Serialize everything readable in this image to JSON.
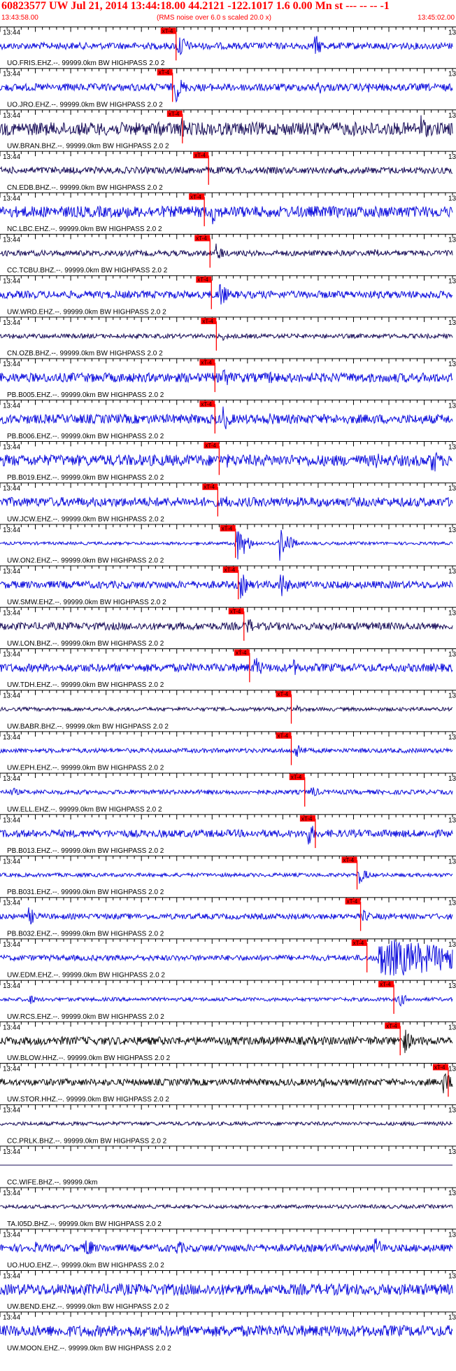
{
  "header": {
    "title": "60823577 UW Jul 21, 2014 13:44:18.00   44.2121 -122.1017  1.6 0.00 Mn st --- -- --  -1",
    "start_time": "13:43:58.00",
    "subtitle": "(RMS noise over 6.0 s scaled 20.0 x)",
    "end_time": "13:45:02.00"
  },
  "colors": {
    "header_text": "#ff0000",
    "pick": "#ff0000",
    "pick_label_text": "#000000",
    "axis": "#000000",
    "trace_blue": "#1010dd",
    "trace_navy": "#1a0f5a",
    "trace_black": "#111111"
  },
  "chart_data": {
    "type": "line",
    "x_unit": "time",
    "x_range": [
      "13:43:58.00",
      "13:45:02.00"
    ],
    "tick_time_label": "13:44",
    "right_edge_label": "13",
    "pick_label": "xT-4",
    "series": [
      {
        "name": "UO.FRIS.EHZ.--. 99999.0km BW HIGHPASS  2.0  2",
        "color": "blue",
        "pick_time": "13:44:22.9",
        "noise": 0.18,
        "events": [
          {
            "time": "13:44:23.2",
            "amp": 0.9
          },
          {
            "time": "13:44:42.5",
            "amp": 0.7
          }
        ]
      },
      {
        "name": "UO.JRO.EHZ.--. 99999.0km BW HIGHPASS  2.0  2",
        "color": "blue",
        "pick_time": "13:44:22.4",
        "noise": 0.2,
        "events": [
          {
            "time": "13:44:22.8",
            "amp": 0.9
          },
          {
            "time": "13:44:33",
            "amp": 0.35
          },
          {
            "time": "13:44:43",
            "amp": 0.45
          },
          {
            "time": "13:44:50",
            "amp": 0.35
          }
        ]
      },
      {
        "name": "UW.BRAN.BHZ.--. 99999.0km BW HIGHPASS  2.0  2",
        "color": "navy",
        "pick_time": "13:44:23.8",
        "noise": 0.35,
        "events": [
          {
            "time": "13:44:23.5",
            "amp": 0.75
          },
          {
            "time": "13:44:48",
            "amp": 0.45
          },
          {
            "time": "13:44:57.5",
            "amp": 0.9
          }
        ]
      },
      {
        "name": "CN.EDB.BHZ.--. 99999.0km BW HIGHPASS  2.0  2",
        "color": "navy",
        "pick_time": "13:44:27.5",
        "noise": 0.18,
        "events": [
          {
            "time": "13:44:28",
            "amp": 0.35
          }
        ]
      },
      {
        "name": "NC.LBC.EHZ.--. 99999.0km BW HIGHPASS  2.0  2",
        "color": "blue",
        "pick_time": "13:44:26.9",
        "noise": 0.3,
        "events": [
          {
            "time": "13:44:28",
            "amp": 0.8
          }
        ]
      },
      {
        "name": "CC.TCBU.BHZ.--. 99999.0km BW HIGHPASS  2.0  2",
        "color": "navy",
        "pick_time": "13:44:27.7",
        "noise": 0.15,
        "events": [
          {
            "time": "13:44:28.5",
            "amp": 0.6
          },
          {
            "time": "13:44:51",
            "amp": 0.3
          }
        ]
      },
      {
        "name": "UW.WRD.EHZ.--. 99999.0km BW HIGHPASS  2.0  2",
        "color": "blue",
        "pick_time": "13:44:27.9",
        "noise": 0.2,
        "events": [
          {
            "time": "13:44:29",
            "amp": 0.85
          }
        ]
      },
      {
        "name": "CN.OZB.BHZ.--. 99999.0km BW HIGHPASS  2.0  2",
        "color": "navy",
        "pick_time": "13:44:28.6",
        "noise": 0.12,
        "events": [
          {
            "time": "13:44:29.3",
            "amp": 0.3
          }
        ]
      },
      {
        "name": "PB.B005.EHZ.--. 99999.0km BW HIGHPASS  2.0  2",
        "color": "blue",
        "pick_time": "13:44:28.4",
        "noise": 0.25,
        "events": [
          {
            "time": "13:44:29.5",
            "amp": 0.75
          },
          {
            "time": "13:44:36",
            "amp": 0.45
          }
        ]
      },
      {
        "name": "PB.B006.EHZ.--. 99999.0km BW HIGHPASS  2.0  2",
        "color": "blue",
        "pick_time": "13:44:28.4",
        "noise": 0.25,
        "events": [
          {
            "time": "13:44:29.5",
            "amp": 0.8
          },
          {
            "time": "13:44:36",
            "amp": 0.55
          }
        ]
      },
      {
        "name": "PB.B019.EHZ.--. 99999.0km BW HIGHPASS  2.0  2",
        "color": "blue",
        "pick_time": "13:44:29.0",
        "noise": 0.3,
        "events": [
          {
            "time": "13:44:30",
            "amp": 0.45
          },
          {
            "time": "13:44:51",
            "amp": 0.6
          },
          {
            "time": "13:44:59",
            "amp": 0.95
          }
        ]
      },
      {
        "name": "UW.JCW.EHZ.--. 99999.0km BW HIGHPASS  2.0  2",
        "color": "blue",
        "pick_time": "13:44:28.8",
        "noise": 0.25,
        "events": [
          {
            "time": "13:44:30",
            "amp": 0.4
          }
        ]
      },
      {
        "name": "UW.ON2.EHZ.--. 99999.0km BW HIGHPASS  2.0  2",
        "color": "blue",
        "pick_time": "13:44:31.3",
        "noise": 0.08,
        "events": [
          {
            "time": "13:44:31.5",
            "amp": 1.0
          },
          {
            "time": "13:44:32.5",
            "amp": 0.6
          },
          {
            "time": "13:44:37.5",
            "amp": 1.0
          },
          {
            "time": "13:44:38.5",
            "amp": 0.6
          }
        ]
      },
      {
        "name": "UW.SMW.EHZ.--. 99999.0km BW HIGHPASS  2.0  2",
        "color": "blue",
        "pick_time": "13:44:31.7",
        "noise": 0.2,
        "events": [
          {
            "time": "13:44:32",
            "amp": 0.8
          },
          {
            "time": "13:44:37.5",
            "amp": 0.95
          }
        ]
      },
      {
        "name": "UW.LON.BHZ.--. 99999.0km BW HIGHPASS  2.0  2",
        "color": "navy",
        "pick_time": "13:44:32.5",
        "noise": 0.2,
        "events": [
          {
            "time": "13:44:33",
            "amp": 0.55
          }
        ]
      },
      {
        "name": "UW.TDH.EHZ.--. 99999.0km BW HIGHPASS  2.0  2",
        "color": "blue",
        "pick_time": "13:44:33.3",
        "noise": 0.22,
        "events": [
          {
            "time": "13:44:34",
            "amp": 0.75
          },
          {
            "time": "13:44:39.5",
            "amp": 0.5
          }
        ]
      },
      {
        "name": "UW.BABR.BHZ.--. 99999.0km BW HIGHPASS  2.0  2",
        "color": "navy",
        "pick_time": "13:44:39.2",
        "noise": 0.1,
        "events": [
          {
            "time": "13:44:40",
            "amp": 0.25
          }
        ]
      },
      {
        "name": "UW.EPH.EHZ.--. 99999.0km BW HIGHPASS  2.0  2",
        "color": "blue",
        "pick_time": "13:44:39.2",
        "noise": 0.12,
        "events": [
          {
            "time": "13:44:39.8",
            "amp": 0.55
          }
        ]
      },
      {
        "name": "UW.ELL.EHZ.--. 99999.0km BW HIGHPASS  2.0  2",
        "color": "blue",
        "pick_time": "13:44:41.1",
        "noise": 0.12,
        "events": [
          {
            "time": "13:43:59.5",
            "amp": 0.35
          },
          {
            "time": "13:44:42",
            "amp": 0.4
          }
        ]
      },
      {
        "name": "PB.B013.EHZ.--. 99999.0km BW HIGHPASS  2.0  2",
        "color": "blue",
        "pick_time": "13:44:42.6",
        "noise": 0.2,
        "events": [
          {
            "time": "13:44:41.5",
            "amp": 0.75
          }
        ]
      },
      {
        "name": "PB.B031.EHZ.--. 99999.0km BW HIGHPASS  2.0  2",
        "color": "blue",
        "pick_time": "13:44:48.5",
        "noise": 0.1,
        "events": [
          {
            "time": "13:44:48.8",
            "amp": 0.55
          }
        ]
      },
      {
        "name": "PB.B032.EHZ.--. 99999.0km BW HIGHPASS  2.0  2",
        "color": "blue",
        "pick_time": "13:44:49.0",
        "noise": 0.15,
        "events": [
          {
            "time": "13:44:02",
            "amp": 0.6
          },
          {
            "time": "13:44:49.2",
            "amp": 0.45
          }
        ]
      },
      {
        "name": "UW.EDM.EHZ.--. 99999.0km BW HIGHPASS  2.0  2",
        "color": "blue",
        "pick_time": "13:44:49.9",
        "noise": 0.15,
        "events": [
          {
            "time": "13:44:51.5",
            "amp": 1.0,
            "long": true
          }
        ]
      },
      {
        "name": "UW.RCS.EHZ.--. 99999.0km BW HIGHPASS  2.0  2",
        "color": "blue",
        "pick_time": "13:44:53.7",
        "noise": 0.1,
        "events": [
          {
            "time": "13:44:02",
            "amp": 0.35
          },
          {
            "time": "13:44:54.3",
            "amp": 0.5
          }
        ]
      },
      {
        "name": "UW.BLOW.HHZ.--. 99999.0km BW HIGHPASS  2.0  2",
        "color": "black",
        "pick_time": "13:44:54.6",
        "noise": 0.22,
        "events": [
          {
            "time": "13:44:55",
            "amp": 0.9
          }
        ]
      },
      {
        "name": "UW.STOR.HHZ.--. 99999.0km BW HIGHPASS  2.0  2",
        "color": "black",
        "pick_time": "13:45:01.4",
        "noise": 0.18,
        "events": [
          {
            "time": "13:44:43.5",
            "amp": 0.35
          },
          {
            "time": "13:45:00.7",
            "amp": 0.8
          }
        ]
      },
      {
        "name": "CC.PRLK.BHZ.--. 99999.0km BW HIGHPASS  2.0  2",
        "color": "navy",
        "pick_time": null,
        "noise": 0.1,
        "events": []
      },
      {
        "name": "CC.WIFE.BHZ.--. 99999.0km",
        "color": "navy",
        "pick_time": null,
        "noise": 0.0,
        "events": []
      },
      {
        "name": "TA.I05D.BHZ.--. 99999.0km BW HIGHPASS  2.0  2",
        "color": "navy",
        "pick_time": null,
        "noise": 0.1,
        "events": []
      },
      {
        "name": "UO.HUO.EHZ.--. 99999.0km BW HIGHPASS  2.0  2",
        "color": "blue",
        "pick_time": null,
        "noise": 0.2,
        "events": [
          {
            "time": "13:44:03",
            "amp": 0.4
          },
          {
            "time": "13:44:10",
            "amp": 0.8
          },
          {
            "time": "13:44:23",
            "amp": 0.55
          },
          {
            "time": "13:44:51",
            "amp": 0.75
          }
        ]
      },
      {
        "name": "UW.BEND.EHZ.--. 99999.0km BW HIGHPASS  2.0  2",
        "color": "blue",
        "pick_time": null,
        "noise": 0.3,
        "events": []
      },
      {
        "name": "UW.MOON.EHZ.--. 99999.0km BW HIGHPASS  2.0  2",
        "color": "blue",
        "pick_time": null,
        "noise": 0.3,
        "events": []
      }
    ]
  }
}
